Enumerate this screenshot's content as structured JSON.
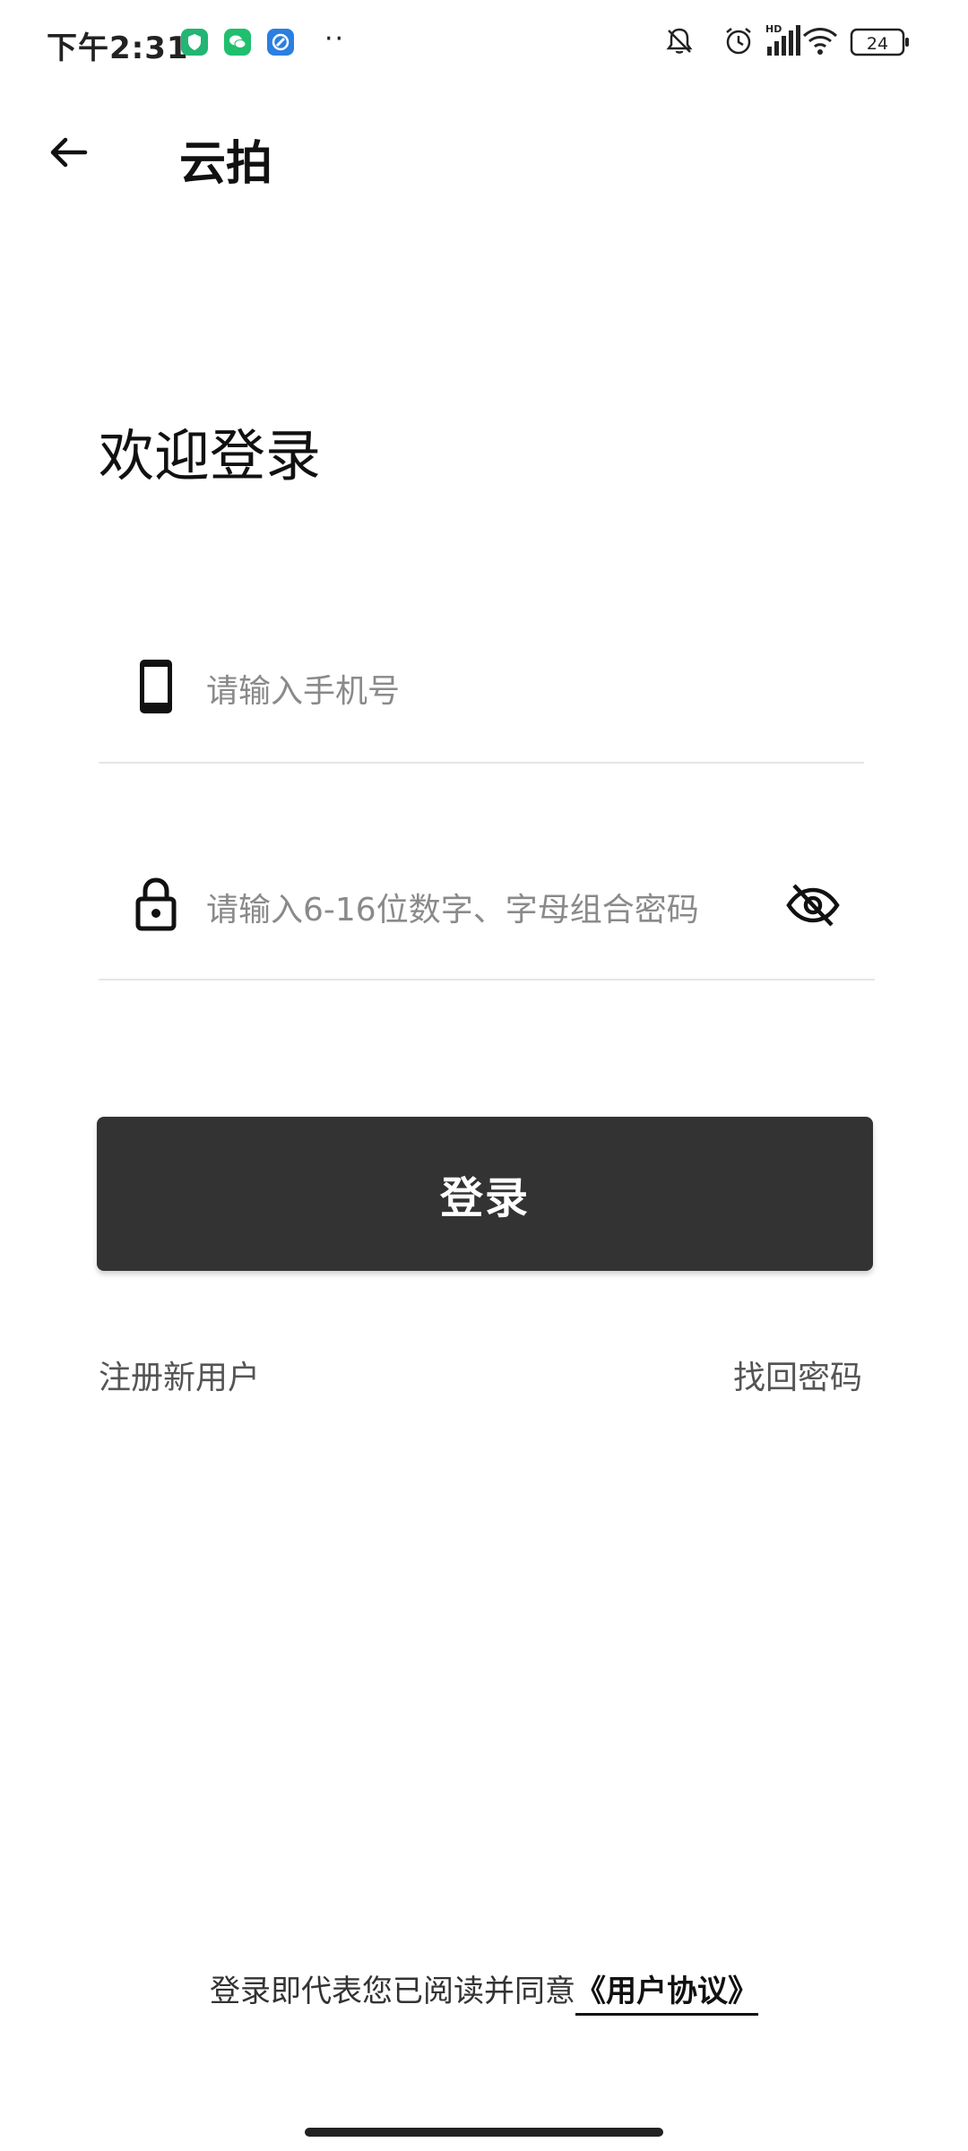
{
  "status_bar": {
    "time": "下午2:31",
    "dots": "··",
    "battery": "24",
    "network": "HD",
    "app_icon_colors": [
      "#22b573",
      "#1fbf6e",
      "#2b7fe0"
    ]
  },
  "header": {
    "back_icon": "arrow-left-icon",
    "title": "云拍"
  },
  "welcome": "欢迎登录",
  "phone_field": {
    "icon": "phone-icon",
    "placeholder": "请输入手机号"
  },
  "password_field": {
    "icon": "lock-icon",
    "placeholder": "请输入6-16位数字、字母组合密码",
    "toggle_icon": "eye-off-icon"
  },
  "login_button": {
    "label": "登录",
    "color": "#333333"
  },
  "links": {
    "register": "注册新用户",
    "forgot_password": "找回密码"
  },
  "agreement": {
    "prefix": "登录即代表您已阅读并同意",
    "link": "《用户协议》"
  }
}
